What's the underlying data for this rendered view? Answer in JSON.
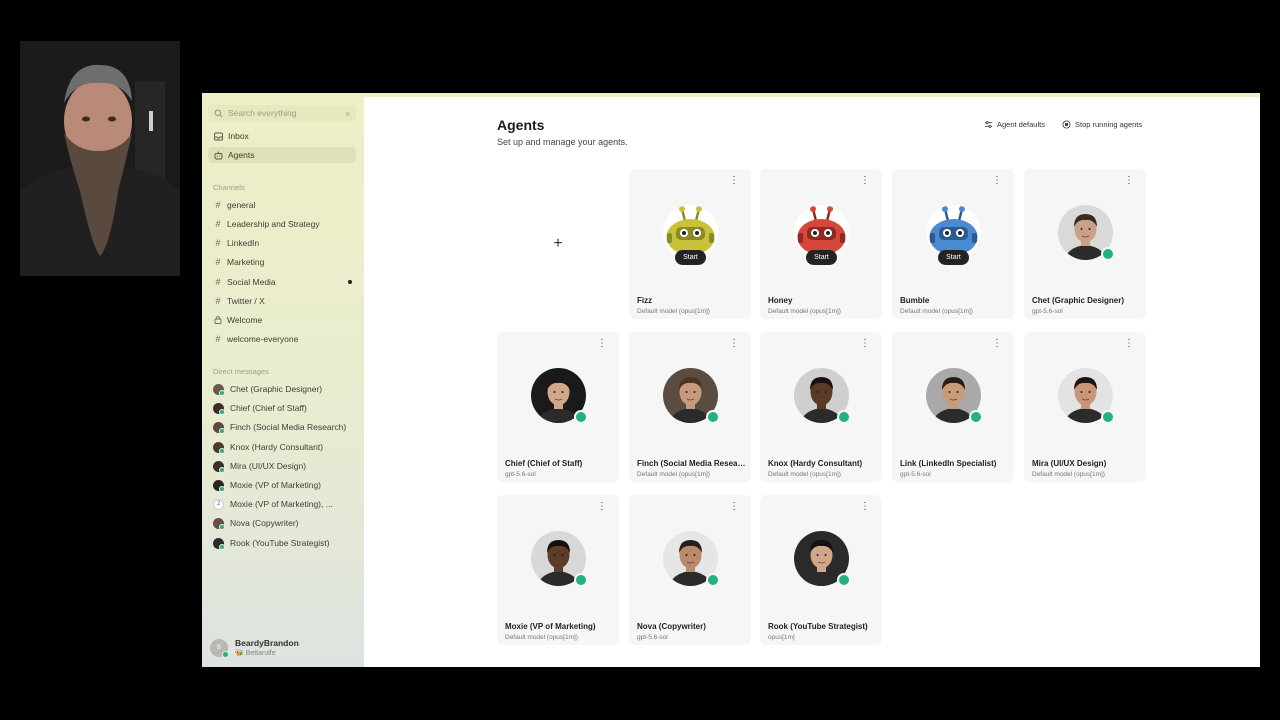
{
  "sidebar": {
    "search_placeholder": "Search everything",
    "collapse_icon": "collapse-icon",
    "nav": [
      {
        "label": "Inbox",
        "icon": "inbox-icon"
      },
      {
        "label": "Agents",
        "icon": "agents-icon"
      }
    ],
    "channels_label": "Channels",
    "channels": [
      {
        "label": "general",
        "unread": false,
        "icon": "hash"
      },
      {
        "label": "Leadership and Strategy",
        "unread": false,
        "icon": "hash"
      },
      {
        "label": "LinkedIn",
        "unread": false,
        "icon": "hash"
      },
      {
        "label": "Marketing",
        "unread": false,
        "icon": "hash"
      },
      {
        "label": "Social Media",
        "unread": true,
        "icon": "hash"
      },
      {
        "label": "Twitter / X",
        "unread": false,
        "icon": "hash"
      },
      {
        "label": "Welcome",
        "unread": false,
        "icon": "lock"
      },
      {
        "label": "welcome-everyone",
        "unread": false,
        "icon": "hash"
      }
    ],
    "dm_label": "Direct messages",
    "dms": [
      {
        "label": "Chet (Graphic Designer)",
        "avatar": "#6b5a4c"
      },
      {
        "label": "Chief (Chief of Staff)",
        "avatar": "#3b3029"
      },
      {
        "label": "Finch (Social Media Research)",
        "avatar": "#5c4a3e"
      },
      {
        "label": "Knox (Hardy Consultant)",
        "avatar": "#4a3a30"
      },
      {
        "label": "Mira (UI/UX Design)",
        "avatar": "#3e2e28"
      },
      {
        "label": "Moxie (VP of Marketing)",
        "avatar": "#2e2420"
      },
      {
        "label": "Moxie (VP of Marketing), ...",
        "avatar": "",
        "count": "2"
      },
      {
        "label": "Nova (Copywriter)",
        "avatar": "#6a4e44"
      },
      {
        "label": "Rook (YouTube Strategist)",
        "avatar": "#2c2a28"
      }
    ],
    "user": {
      "initial": "B",
      "name": "BeardyBrandon",
      "status": "🐝 Bettarulfe"
    }
  },
  "main": {
    "title": "Agents",
    "subtitle": "Set up and manage your agents.",
    "agent_defaults_label": "Agent defaults",
    "stop_label": "Stop running agents",
    "start_label": "Start",
    "menu_glyph": "⋮",
    "plus_glyph": "+",
    "agents": [
      {
        "name": "Fizz",
        "model": "Default model (opus[1m])",
        "type": "robot",
        "color": "#c8c23a",
        "accent": "#8b8a25",
        "start": true
      },
      {
        "name": "Honey",
        "model": "Default model (opus[1m])",
        "type": "robot",
        "color": "#d4473a",
        "accent": "#8e2a22",
        "start": true
      },
      {
        "name": "Bumble",
        "model": "Default model (opus[1m])",
        "type": "robot",
        "color": "#4a8ad0",
        "accent": "#2c5a92",
        "start": true
      },
      {
        "name": "Chet (Graphic Designer)",
        "model": "gpt-5.6-sol",
        "type": "person",
        "skin": "#c9a184",
        "hair": "#3b2a20",
        "bg": "#d9d9d9",
        "online": true
      },
      {
        "name": "Chief (Chief of Staff)",
        "model": "gpt-5.6-sol",
        "type": "person",
        "skin": "#d1a78a",
        "hair": "#1e1612",
        "bg": "#1a1a1a",
        "online": true
      },
      {
        "name": "Finch (Social Media Research)",
        "model": "Default model (opus[1m])",
        "type": "person",
        "skin": "#c69a7b",
        "hair": "#4a3626",
        "bg": "#5a4c40",
        "online": true
      },
      {
        "name": "Knox (Hardy Consultant)",
        "model": "Default model (opus[1m])",
        "type": "person",
        "skin": "#5a3a26",
        "hair": "#1a1210",
        "bg": "#cfcfcf",
        "online": true
      },
      {
        "name": "Link (LinkedIn Specialist)",
        "model": "gpt-5.6-sol",
        "type": "person",
        "skin": "#c99a7a",
        "hair": "#2a1c14",
        "bg": "#a9a9a9",
        "online": true
      },
      {
        "name": "Mira (UI/UX Design)",
        "model": "Default model (opus[1m])",
        "type": "person",
        "skin": "#c8977a",
        "hair": "#1c1410",
        "bg": "#e3e3e3",
        "online": true
      },
      {
        "name": "Moxie (VP of Marketing)",
        "model": "Default model (opus[1m])",
        "type": "person",
        "skin": "#5e3c2a",
        "hair": "#141010",
        "bg": "#d8d8d8",
        "online": true
      },
      {
        "name": "Nova (Copywriter)",
        "model": "gpt-5.6-sol",
        "type": "person",
        "skin": "#b98a6c",
        "hair": "#2a1e18",
        "bg": "#e6e6e6",
        "online": true
      },
      {
        "name": "Rook (YouTube Strategist)",
        "model": "opus[1m]",
        "type": "person",
        "skin": "#d0a888",
        "hair": "#121010",
        "bg": "#2a2a2a",
        "online": true
      }
    ]
  },
  "webcam": {
    "label": ""
  }
}
